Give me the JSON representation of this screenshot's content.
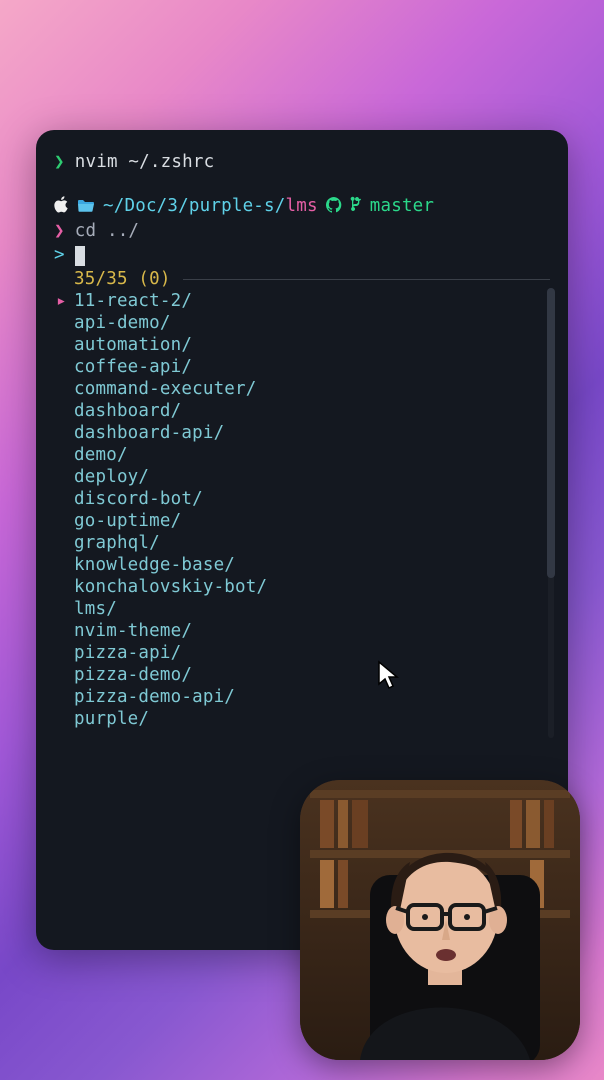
{
  "top_command": {
    "prompt": "❯",
    "text": "nvim ~/.zshrc"
  },
  "path_segments": {
    "prefix": "~/Doc/3/purple-s/",
    "tail": "lms"
  },
  "branch": "master",
  "cd": {
    "prompt": "❯",
    "text": "cd ../"
  },
  "fzf_prompt": ">",
  "counter": "35/35 (0)",
  "selected_marker": "▸",
  "entries": [
    "11-react-2/",
    "api-demo/",
    "automation/",
    "coffee-api/",
    "command-executer/",
    "dashboard/",
    "dashboard-api/",
    "demo/",
    "deploy/",
    "discord-bot/",
    "go-uptime/",
    "graphql/",
    "knowledge-base/",
    "konchalovskiy-bot/",
    "lms/",
    "nvim-theme/",
    "pizza-api/",
    "pizza-demo/",
    "pizza-demo-api/",
    "purple/"
  ],
  "selected_index": 0
}
